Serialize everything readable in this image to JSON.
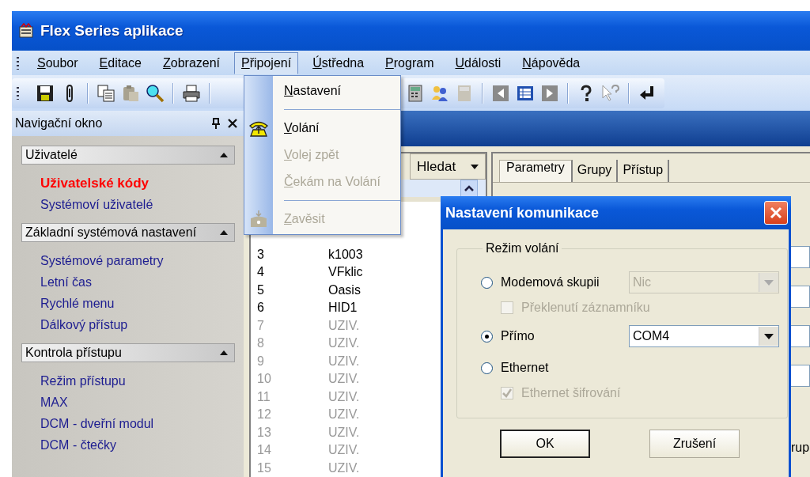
{
  "window": {
    "title": "Flex Series aplikace"
  },
  "menu_bar": [
    {
      "label": "Soubor",
      "selected": false
    },
    {
      "label": "Editace",
      "selected": false
    },
    {
      "label": "Zobrazení",
      "selected": false
    },
    {
      "label": "Připojení",
      "selected": true
    },
    {
      "label": "Ústředna",
      "selected": false
    },
    {
      "label": "Program",
      "selected": false
    },
    {
      "label": "Události",
      "selected": false
    },
    {
      "label": "Nápověda",
      "selected": false
    }
  ],
  "connection_menu": [
    {
      "kind": "item",
      "label": "Nastavení",
      "disabled": false
    },
    {
      "kind": "separator"
    },
    {
      "kind": "call-item",
      "label": "Volání",
      "disabled": false
    },
    {
      "kind": "item",
      "label": "Volej zpět",
      "disabled": true
    },
    {
      "kind": "item",
      "label": "Čekám na Volání",
      "disabled": true
    },
    {
      "kind": "separator"
    },
    {
      "kind": "hangup-item",
      "label": "Zavěsit",
      "disabled": true
    }
  ],
  "navigation": {
    "title": "Navigační okno",
    "sections": [
      {
        "title": "Uživatelé",
        "expanded": true,
        "items": [
          {
            "label": "Uživatelské kódy",
            "selected": true
          },
          {
            "label": "Systémoví uživatelé",
            "selected": false
          }
        ]
      },
      {
        "title": "Základní systémová nastavení",
        "expanded": true,
        "items": [
          {
            "label": "Systémové parametry",
            "selected": false
          },
          {
            "label": "Letní čas",
            "selected": false
          },
          {
            "label": "Rychlé menu",
            "selected": false
          },
          {
            "label": "Dálkový přístup",
            "selected": false
          }
        ]
      },
      {
        "title": "Kontrola přístupu",
        "expanded": true,
        "items": [
          {
            "label": "Režim přístupu",
            "selected": false
          },
          {
            "label": "MAX",
            "selected": false
          },
          {
            "label": "DCM - dveřní modul",
            "selected": false
          },
          {
            "label": "DCM - čtečky",
            "selected": false
          }
        ]
      }
    ]
  },
  "search_button": {
    "label": "Hledat"
  },
  "users_table": {
    "rows": [
      {
        "column_1": "3",
        "column_2": "k1003",
        "disabled": false
      },
      {
        "column_1": "4",
        "column_2": "VFklic",
        "disabled": false
      },
      {
        "column_1": "5",
        "column_2": "Oasis",
        "disabled": false
      },
      {
        "column_1": "6",
        "column_2": "HID1",
        "disabled": false
      },
      {
        "column_1": "7",
        "column_2": "UZIV.",
        "disabled": true
      },
      {
        "column_1": "8",
        "column_2": "UZIV.",
        "disabled": true
      },
      {
        "column_1": "9",
        "column_2": "UZIV.",
        "disabled": true
      },
      {
        "column_1": "10",
        "column_2": "UZIV.",
        "disabled": true
      },
      {
        "column_1": "11",
        "column_2": "UZIV.",
        "disabled": true
      },
      {
        "column_1": "12",
        "column_2": "UZIV.",
        "disabled": true
      },
      {
        "column_1": "13",
        "column_2": "UZIV.",
        "disabled": true
      },
      {
        "column_1": "14",
        "column_2": "UZIV.",
        "disabled": true
      },
      {
        "column_1": "15",
        "column_2": "UZIV.",
        "disabled": true
      }
    ]
  },
  "detail_tabs": [
    {
      "label": "Parametry",
      "selected": true
    },
    {
      "label": "Grupy",
      "selected": false
    },
    {
      "label": "Přístup",
      "selected": false
    }
  ],
  "detail_label": "rup",
  "dialog": {
    "title": "Nastavení komunikace",
    "group": "Režim volání",
    "options": [
      {
        "label": "Modemová skupii",
        "selected": false,
        "combo": {
          "value": "Nic",
          "disabled": true
        },
        "checkbox": {
          "label": "Překlenutí záznamníku",
          "checked": false,
          "disabled": true
        }
      },
      {
        "label": "Přímo",
        "selected": true,
        "combo": {
          "value": "COM4",
          "disabled": false
        }
      },
      {
        "label": "Ethernet",
        "selected": false,
        "checkbox": {
          "label": "Ethernet šifrování",
          "checked": true,
          "disabled": true
        }
      }
    ],
    "buttons": [
      {
        "label": "OK",
        "default": true
      },
      {
        "label": "Zrušení",
        "default": false
      }
    ]
  }
}
